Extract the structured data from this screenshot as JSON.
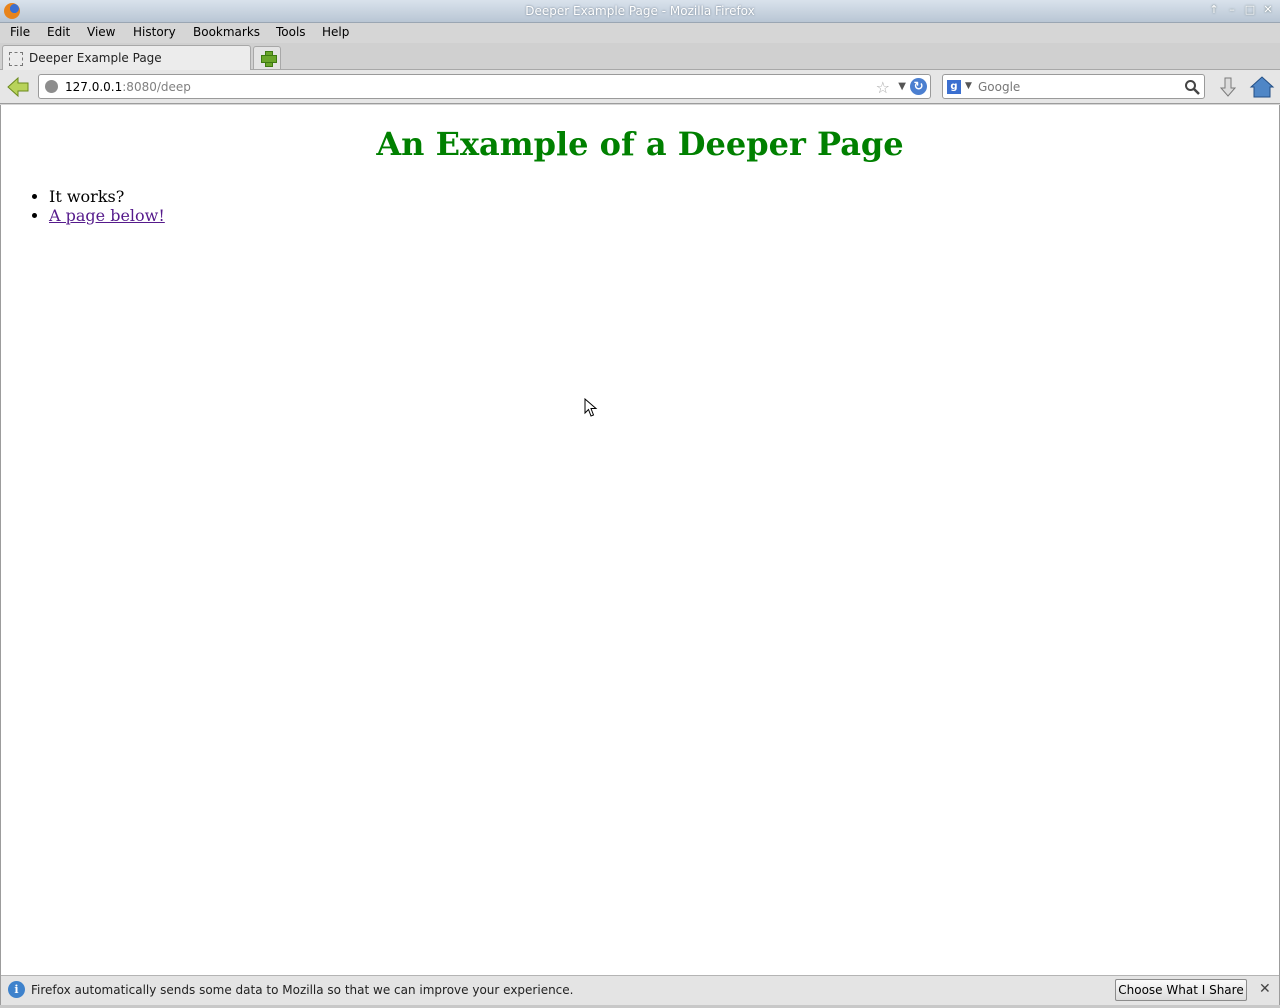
{
  "window": {
    "title": "Deeper Example Page - Mozilla Firefox",
    "controls": [
      "↑",
      "–",
      "□",
      "✕"
    ]
  },
  "menu": [
    "File",
    "Edit",
    "View",
    "History",
    "Bookmarks",
    "Tools",
    "Help"
  ],
  "tab": {
    "label": "Deeper Example Page"
  },
  "navbar": {
    "url_host": "127.0.0.1",
    "url_rest": ":8080/deep",
    "search_placeholder": "Google"
  },
  "page": {
    "heading": "An Example of a Deeper Page",
    "heading_color": "#008000",
    "items": [
      {
        "text": "It works?"
      },
      {
        "text": "A page below!",
        "link_color": "#551a8b"
      }
    ]
  },
  "notification": {
    "message": "Firefox automatically sends some data to Mozilla so that we can improve your experience.",
    "button_label": "Choose What I Share",
    "close": "✕"
  }
}
